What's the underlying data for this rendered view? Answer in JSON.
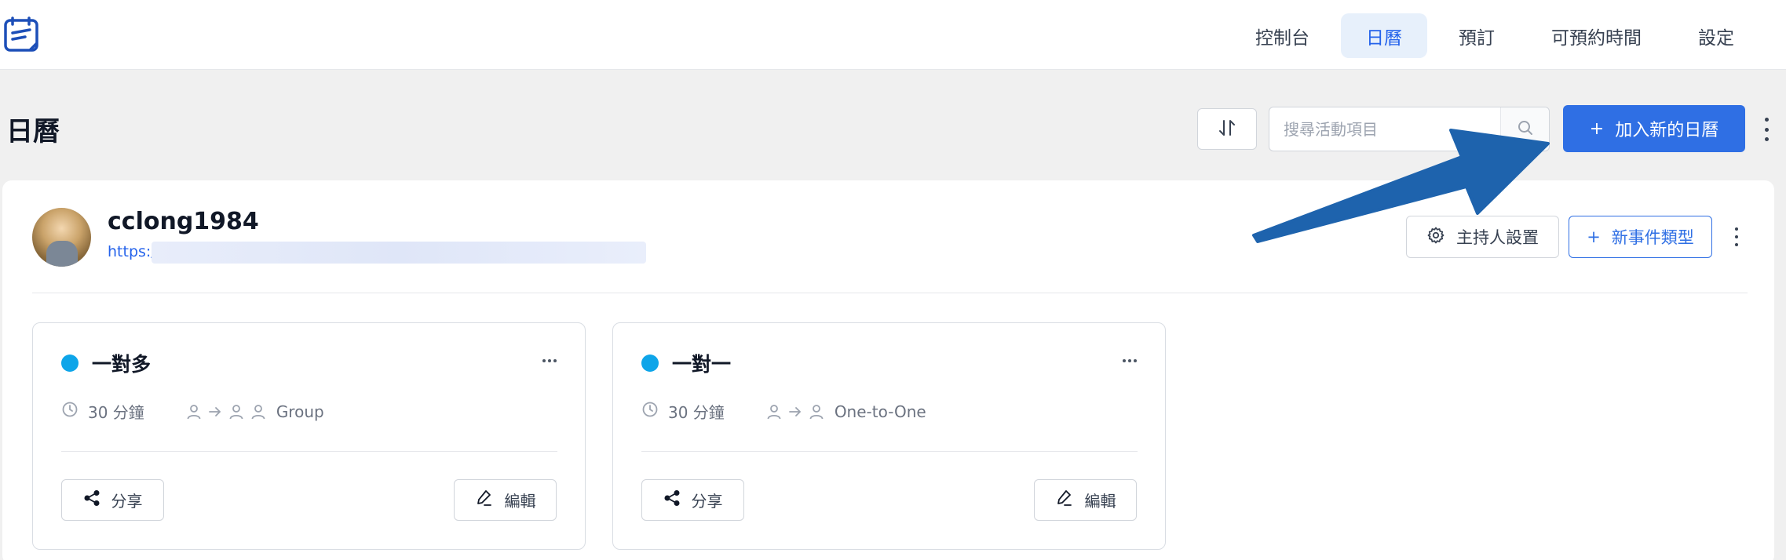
{
  "nav": {
    "items": [
      {
        "label": "控制台",
        "active": false
      },
      {
        "label": "日曆",
        "active": true
      },
      {
        "label": "預訂",
        "active": false
      },
      {
        "label": "可預約時間",
        "active": false
      },
      {
        "label": "設定",
        "active": false
      }
    ]
  },
  "page": {
    "title": "日曆",
    "search_placeholder": "搜尋活動項目",
    "add_calendar_label": "加入新的日曆",
    "plus_icon": "+"
  },
  "profile": {
    "name": "cclong1984",
    "url_prefix": "https:/",
    "host_settings_label": "主持人設置",
    "new_event_type_label": "新事件類型"
  },
  "events": [
    {
      "title": "一對多",
      "duration": "30 分鐘",
      "type": "Group",
      "share_label": "分享",
      "edit_label": "編輯"
    },
    {
      "title": "一對一",
      "duration": "30 分鐘",
      "type": "One-to-One",
      "share_label": "分享",
      "edit_label": "編輯"
    }
  ],
  "colors": {
    "primary": "#2f6fe4",
    "event_dot": "#0ea5e9",
    "annotation_arrow": "#1e63ad"
  }
}
